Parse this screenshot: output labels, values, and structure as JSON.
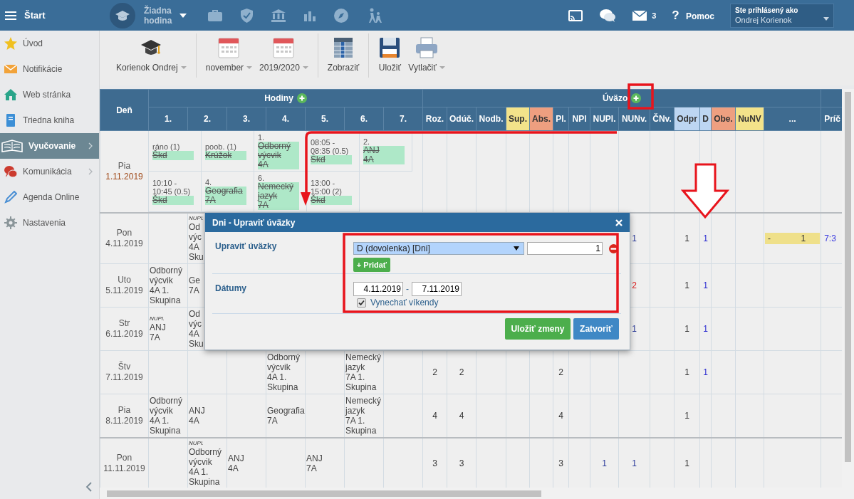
{
  "topbar": {
    "menu_label": "Štart",
    "lesson": "Žiadna hodina",
    "mail_count": "3",
    "help_glyph": "?",
    "help_label": "Pomoc",
    "user_caption": "Ste prihlásený ako",
    "user_name": "Ondrej Korienok"
  },
  "sidebar": {
    "items": [
      {
        "label": "Úvod",
        "selected": false,
        "submenu": false
      },
      {
        "label": "Notifikácie",
        "selected": false,
        "submenu": false
      },
      {
        "label": "Web stránka",
        "selected": false,
        "submenu": false
      },
      {
        "label": "Triedna kniha",
        "selected": false,
        "submenu": false
      },
      {
        "label": "Vyučovanie",
        "selected": true,
        "submenu": true
      },
      {
        "label": "Komunikácia",
        "selected": false,
        "submenu": true
      },
      {
        "label": "Agenda Online",
        "selected": false,
        "submenu": false
      },
      {
        "label": "Nastavenia",
        "selected": false,
        "submenu": false
      }
    ]
  },
  "toolbar": {
    "items": [
      {
        "label": "Korienok Ondrej",
        "dropdown": true,
        "group_end": true
      },
      {
        "label": "november",
        "dropdown": true,
        "group_end": false
      },
      {
        "label": "2019/2020",
        "dropdown": true,
        "group_end": true
      },
      {
        "label": "Zobraziť",
        "dropdown": false,
        "group_end": true
      },
      {
        "label": "Uložiť",
        "dropdown": false,
        "group_end": false
      },
      {
        "label": "Vytlačiť",
        "dropdown": true,
        "group_end": false
      }
    ]
  },
  "table": {
    "day_header": "Deň",
    "hours_header": "Hodiny",
    "load_header": "Úväzo",
    "extra_header": "Príč",
    "hour_columns": [
      "1.",
      "2.",
      "3.",
      "4.",
      "5.",
      "6.",
      "7."
    ],
    "load_columns": [
      {
        "label": "Roz."
      },
      {
        "label": "Odúč."
      },
      {
        "label": "Nodb."
      },
      {
        "label": "Sup.",
        "color": "#f3e38a"
      },
      {
        "label": "Abs.",
        "color": "#ee9f80"
      },
      {
        "label": "Pl."
      },
      {
        "label": "NPl"
      },
      {
        "label": "NUPl."
      },
      {
        "label": "NUNv."
      },
      {
        "label": "ČNv."
      },
      {
        "label": "Odpr",
        "color": "#bdd6f2"
      },
      {
        "label": "D",
        "color": "#bdd6f2"
      },
      {
        "label": "Obe.",
        "color": "#ee9f80"
      },
      {
        "label": "NuNV",
        "color": "#f3e38a"
      },
      {
        "label": "..."
      }
    ],
    "rows": [
      {
        "day": "Pia",
        "date": "1.11.2019",
        "date_marked": true,
        "week_start": false,
        "kind": "blocks",
        "blocks": [
          [
            {
              "note": [
                "ráno (1)"
              ],
              "subject": [
                "Škd"
              ],
              "struck": true
            },
            {
              "note": [
                "poob. (1)"
              ],
              "subject": [
                "Krúžok"
              ],
              "struck": true
            },
            {
              "note": [
                "1."
              ],
              "subject": [
                "Odborný",
                "výcvik",
                "4A"
              ],
              "struck": true
            },
            {
              "note": [
                "08:05 -",
                "08:35 (0.5)"
              ],
              "subject": [
                "Škd"
              ],
              "struck": true
            },
            {
              "note": [
                "2."
              ],
              "subject": [
                "ANJ",
                "4A"
              ],
              "struck": true
            }
          ],
          [
            {
              "note": [
                "10:10 -",
                "10:45 (0.5)"
              ],
              "subject": [
                "Škd"
              ],
              "struck": true
            },
            {
              "note": [
                "4."
              ],
              "subject": [
                "Geografia",
                "7A"
              ],
              "struck": true
            },
            {
              "note": [
                "6."
              ],
              "subject": [
                "Nemecký",
                "jazyk",
                "7A"
              ],
              "struck": true
            },
            {
              "note": [
                "13:00 -",
                "15:00 (2)"
              ],
              "subject": [
                "Škd"
              ],
              "struck": true
            }
          ]
        ]
      },
      {
        "day": "Pon",
        "date": "4.11.2019",
        "date_marked": false,
        "week_start": true,
        "kind": "hours",
        "hours": {
          "col_2": {
            "note": "NUPl.",
            "lines": [
              "Od",
              "výc",
              "4A",
              "Sku"
            ]
          }
        },
        "load": {
          "load_9": {
            "kind": "text",
            "value": "1",
            "color": "#2a3a9a"
          },
          "load_11": {
            "kind": "text",
            "value": "1",
            "color": "#333333"
          },
          "load_12": {
            "kind": "text",
            "value": "1",
            "color": "#2a2ad0"
          },
          "load_15": {
            "kind": "bar",
            "parts": [
              "-",
              "1"
            ],
            "color": "#efe08a"
          },
          "extra": {
            "kind": "text",
            "value": "7:3",
            "color": "#3a3ae0"
          }
        }
      },
      {
        "day": "Uto",
        "date": "5.11.2019",
        "date_marked": false,
        "week_start": false,
        "kind": "hours",
        "hours": {
          "col_1": {
            "lines": [
              "Odborný",
              "výcvik",
              "4A 1.",
              "Skupina"
            ]
          },
          "col_2": {
            "lines": [
              "Ge",
              "7A"
            ]
          }
        },
        "load": {
          "load_9": {
            "kind": "text",
            "value": "2",
            "color": "#e02020"
          },
          "load_11": {
            "kind": "text",
            "value": "1",
            "color": "#333333"
          },
          "load_12": {
            "kind": "text",
            "value": "1",
            "color": "#2a2ad0"
          }
        }
      },
      {
        "day": "Str",
        "date": "6.11.2019",
        "date_marked": false,
        "week_start": false,
        "kind": "hours",
        "hours": {
          "col_1": {
            "note": "NUPl.",
            "lines": [
              "ANJ",
              "7A"
            ]
          },
          "col_2": {
            "lines": [
              "Od",
              "výc",
              "4A",
              "Sku"
            ]
          }
        },
        "load": {
          "load_9": {
            "kind": "text",
            "value": "1",
            "color": "#2a3a9a"
          },
          "load_11": {
            "kind": "text",
            "value": "1",
            "color": "#333333"
          },
          "load_12": {
            "kind": "text",
            "value": "1",
            "color": "#2a2ad0"
          }
        }
      },
      {
        "day": "Štv",
        "date": "7.11.2019",
        "date_marked": false,
        "week_start": false,
        "kind": "hours",
        "hours": {
          "col_4": {
            "lines": [
              "Odborný",
              "výcvik",
              "4A 1.",
              "Skupina"
            ]
          },
          "col_6": {
            "lines": [
              "Nemecký",
              "jazyk",
              "7A 1.",
              "Skupina"
            ]
          }
        },
        "load": {
          "load_1": {
            "kind": "text",
            "value": "2",
            "color": "#333333"
          },
          "load_2": {
            "kind": "text",
            "value": "2",
            "color": "#333333"
          },
          "load_6": {
            "kind": "text",
            "value": "2",
            "color": "#333333"
          },
          "load_11": {
            "kind": "text",
            "value": "1",
            "color": "#333333"
          },
          "load_12": {
            "kind": "text",
            "value": "1",
            "color": "#2a2ad0"
          }
        }
      },
      {
        "day": "Pia",
        "date": "8.11.2019",
        "date_marked": false,
        "week_start": false,
        "kind": "hours",
        "hours": {
          "col_1": {
            "lines": [
              "Odborný",
              "výcvik",
              "4A 1.",
              "Skupina"
            ]
          },
          "col_2": {
            "lines": [
              "ANJ",
              "4A"
            ]
          },
          "col_4": {
            "lines": [
              "Geografia",
              "7A"
            ]
          },
          "col_6": {
            "lines": [
              "Nemecký",
              "jazyk",
              "7A 1.",
              "Skupina"
            ]
          }
        },
        "load": {
          "load_1": {
            "kind": "text",
            "value": "4",
            "color": "#333333"
          },
          "load_2": {
            "kind": "text",
            "value": "4",
            "color": "#333333"
          },
          "load_6": {
            "kind": "text",
            "value": "4",
            "color": "#333333"
          },
          "load_11": {
            "kind": "text",
            "value": "1",
            "color": "#333333"
          }
        }
      },
      {
        "day": "Pon",
        "date": "11.11.2019",
        "date_marked": false,
        "week_start": true,
        "kind": "hours",
        "hours": {
          "col_2": {
            "note": "NUPl.",
            "lines": [
              "Odborný",
              "výcvik",
              "4A 1.",
              "Skupina"
            ]
          },
          "col_3": {
            "lines": [
              "ANJ",
              "4A"
            ]
          },
          "col_5": {
            "lines": [
              "ANJ",
              "7A"
            ]
          }
        },
        "load": {
          "load_1": {
            "kind": "text",
            "value": "3",
            "color": "#333333"
          },
          "load_2": {
            "kind": "text",
            "value": "3",
            "color": "#333333"
          },
          "load_6": {
            "kind": "text",
            "value": "3",
            "color": "#333333"
          },
          "load_8": {
            "kind": "text",
            "value": "1",
            "color": "#2a3a9a"
          },
          "load_9": {
            "kind": "text",
            "value": "1",
            "color": "#2a3a9a"
          },
          "load_11": {
            "kind": "text",
            "value": "1",
            "color": "#333333"
          }
        }
      }
    ]
  },
  "dialog": {
    "title": "Dni - Upraviť úväzky",
    "load_label": "Upraviť úväzky",
    "load_type": "D (dovolenka) [Dni]",
    "load_amount": "1",
    "add_label": "+ Pridať",
    "dates_label": "Dátumy",
    "date_from": "4.11.2019",
    "date_separator": "-",
    "date_to": "7.11.2019",
    "skip_weekends": true,
    "skip_weekends_label": "Vynechať víkendy",
    "buttons": [
      {
        "label": "Uložiť zmeny",
        "kind": "primary"
      },
      {
        "label": "Zatvoriť",
        "kind": "secondary"
      }
    ]
  }
}
